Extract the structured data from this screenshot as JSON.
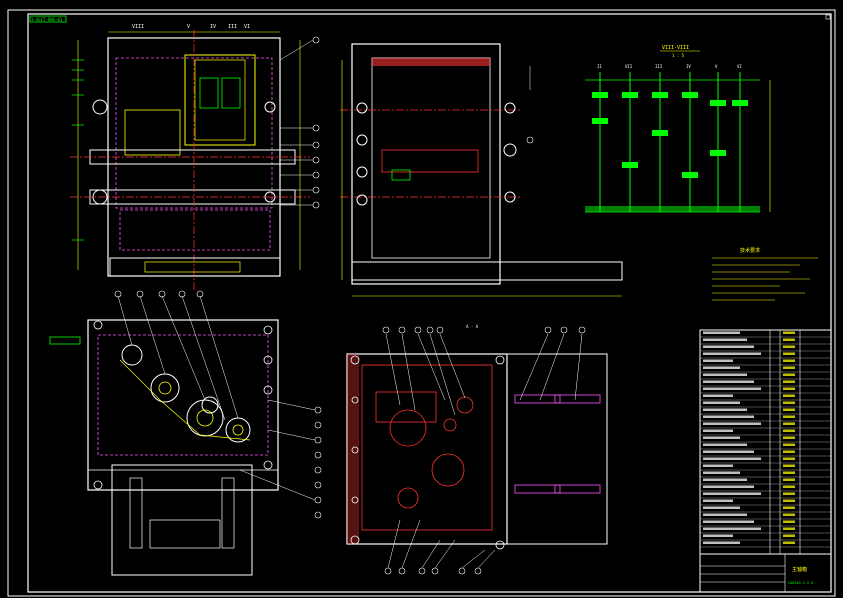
{
  "drawing": {
    "title_tag": "1-SECT-DWG-01",
    "section_label": "A - A",
    "gear_diagram_title": "VIII-VIII",
    "gear_diagram_scale": "1 : 5",
    "notes_heading": "技术要求",
    "title_block_name": "主轴箱",
    "title_block_code": "CA6140-1.2.5"
  },
  "shaft_labels": [
    "VIII",
    "V",
    "IV",
    "III",
    "VI",
    "II",
    "VII",
    "I"
  ],
  "gear_shaft_labels": [
    "II",
    "VII",
    "III",
    "IV",
    "V",
    "VI",
    "VIII",
    "IX"
  ],
  "balloons_front": [
    "18",
    "19",
    "20",
    "21",
    "22",
    "23",
    "24",
    "25",
    "26"
  ],
  "balloons_side": [
    "8",
    "7",
    "6",
    "5",
    "4",
    "3",
    "2",
    "1"
  ],
  "balloons_bottom": [
    "30",
    "31",
    "32",
    "33",
    "34",
    "35",
    "36",
    "37"
  ],
  "balloons_right_col": [
    "9",
    "10",
    "11",
    "12",
    "13",
    "14",
    "15",
    "16",
    "17"
  ],
  "colors": {
    "frame": "#ffffff",
    "outline": "#ffffff",
    "dims": "#ffff00",
    "centerline": "#ff3333",
    "hidden": "#ff55ff",
    "parts": "#00ff66",
    "leaders": "#ffffff",
    "section_hatch": "#ff3333",
    "gear_hatch": "#00ff00",
    "cyan": "#00ffff"
  }
}
